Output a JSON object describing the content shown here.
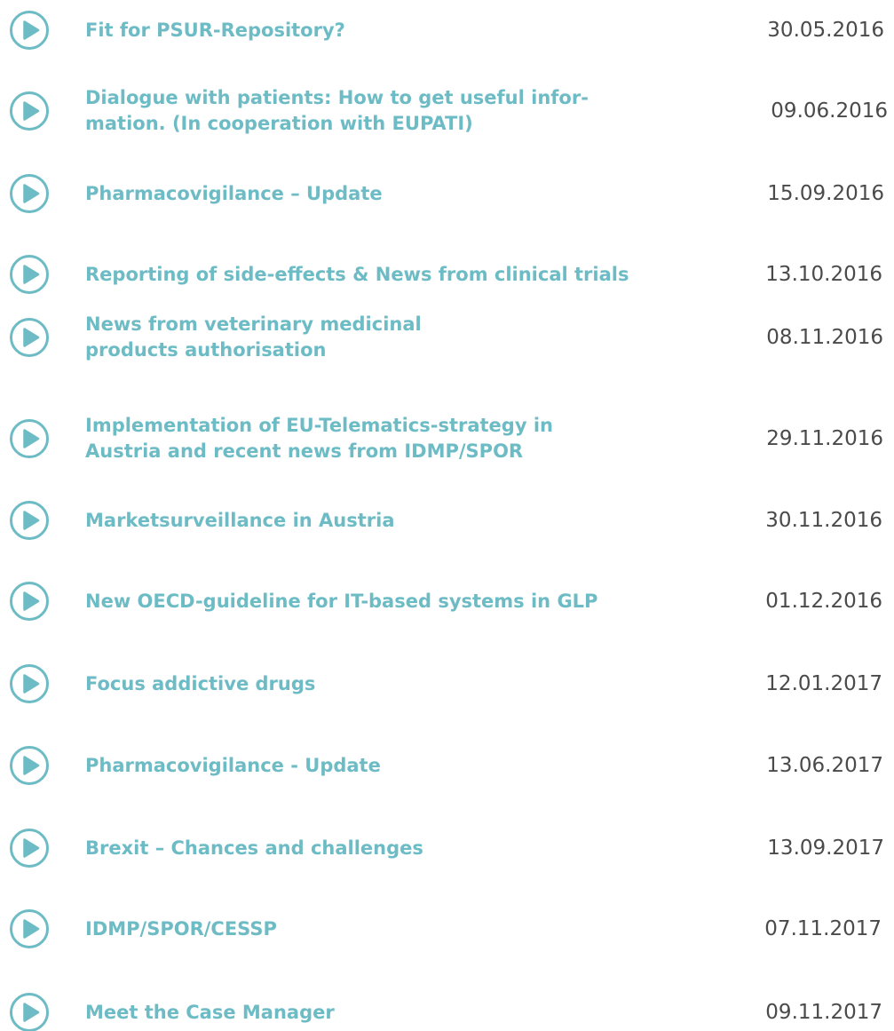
{
  "colors": {
    "accent": "#6dbcc5",
    "date_text": "#4a4a4a",
    "background": "#ffffff"
  },
  "icons": {
    "play": "play-circle-icon"
  },
  "items": [
    {
      "title": "Fit for PSUR-Repository?",
      "date": "30.05.2016"
    },
    {
      "title": "Dialogue with patients: How to get useful infor-\nmation. (In cooperation with EUPATI)",
      "date": "09.06.2016"
    },
    {
      "title": "Pharmacovigilance – Update",
      "date": "15.09.2016"
    },
    {
      "title": "Reporting of side-effects & News from clinical trials",
      "date": "13.10.2016"
    },
    {
      "title": "News from veterinary medicinal\nproducts authorisation",
      "date": "08.11.2016"
    },
    {
      "title": "Implementation of EU-Telematics-strategy in\nAustria and recent news from IDMP/SPOR",
      "date": "29.11.2016"
    },
    {
      "title": "Marketsurveillance in Austria",
      "date": "30.11.2016"
    },
    {
      "title": "New OECD-guideline for IT-based systems in GLP",
      "date": "01.12.2016"
    },
    {
      "title": "Focus addictive drugs",
      "date": "12.01.2017"
    },
    {
      "title": "Pharmacovigilance - Update",
      "date": "13.06.2017"
    },
    {
      "title": "Brexit – Chances and challenges",
      "date": "13.09.2017"
    },
    {
      "title": "IDMP/SPOR/CESSP",
      "date": "07.11.2017"
    },
    {
      "title": "Meet the Case Manager",
      "date": "09.11.2017"
    }
  ]
}
